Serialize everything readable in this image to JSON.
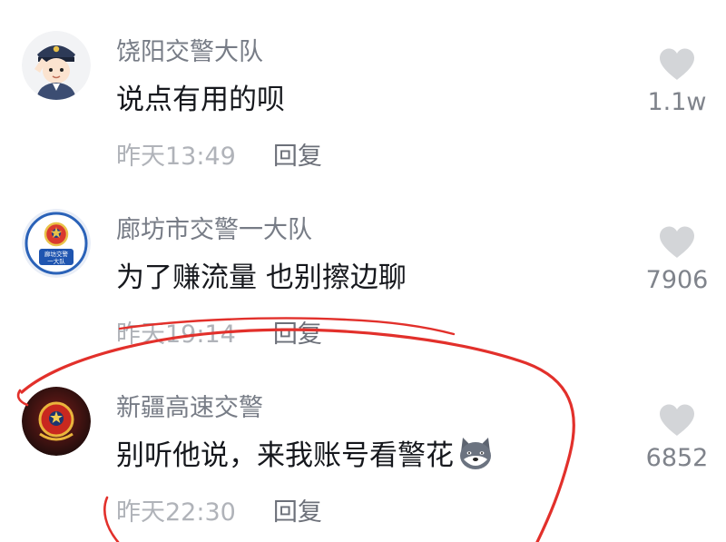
{
  "comments": [
    {
      "username": "饶阳交警大队",
      "text": "说点有用的呗",
      "time": "昨天13:49",
      "reply": "回复",
      "likes": "1.1w",
      "avatar": "police-officer-cartoon-avatar"
    },
    {
      "username": "廊坊市交警一大队",
      "text": "为了赚流量 也别擦边聊",
      "time": "昨天19:14",
      "reply": "回复",
      "likes": "7906",
      "avatar": "police-emblem-badge-avatar",
      "avatar_caption": [
        "廊坊交警",
        "一大队"
      ]
    },
    {
      "username": "新疆高速交警",
      "text": "别听他说，来我账号看警花",
      "time": "昨天22:30",
      "reply": "回复",
      "likes": "6852",
      "avatar": "police-emblem-dark-avatar",
      "emoji": "doge-emoji"
    }
  ],
  "colors": {
    "username": "#777c86",
    "text": "#16181d",
    "time": "#b0b3b9",
    "reply": "#6c7079",
    "heart": "#d3d5d8",
    "annotation": "#e2302b"
  },
  "icons": {
    "like": "heart-icon"
  }
}
